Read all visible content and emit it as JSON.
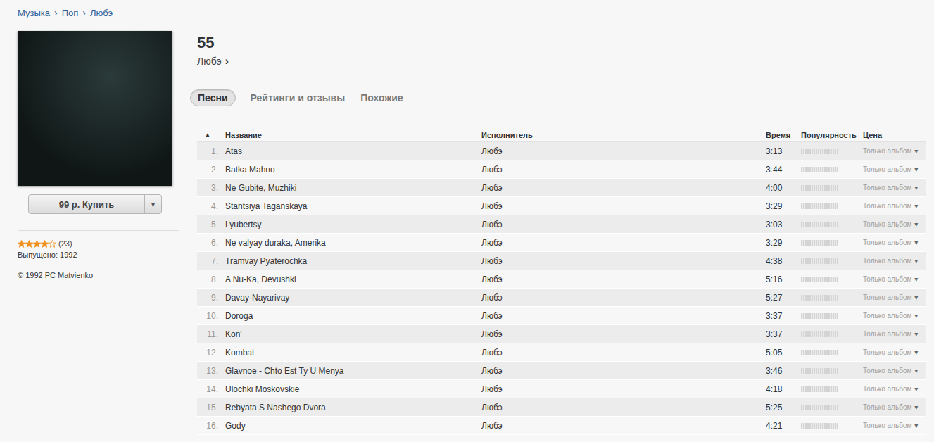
{
  "breadcrumb": {
    "items": [
      "Музыка",
      "Поп",
      "Любэ"
    ],
    "separator": "›"
  },
  "album": {
    "title": "55",
    "artist": "Любэ",
    "artist_arrow": "›",
    "buy_button": "99 р. Купить",
    "buy_menu": "▾",
    "rating": {
      "stars": 4,
      "count": "(23)"
    },
    "released": "Выпущено: 1992",
    "copyright": "© 1992 PC Matvienko"
  },
  "tabs": [
    {
      "label": "Песни",
      "selected": true
    },
    {
      "label": "Рейтинги и отзывы",
      "selected": false
    },
    {
      "label": "Похожие",
      "selected": false
    }
  ],
  "table": {
    "columns": [
      "▲",
      "Название",
      "Исполнитель",
      "Время",
      "Популярность",
      "Цена"
    ],
    "rows": [
      {
        "number": "1.",
        "title": "Atas",
        "artist": "Любэ",
        "time": "3:13",
        "level": 0,
        "price": "Только альбом",
        "menu": "▾"
      },
      {
        "number": "2.",
        "title": "Batka Mahno",
        "artist": "Любэ",
        "time": "3:44",
        "level": 0,
        "price": "Только альбом",
        "menu": "▾"
      },
      {
        "number": "3.",
        "title": "Ne Gubite, Muzhiki",
        "artist": "Любэ",
        "time": "4:00",
        "level": 0,
        "price": "Только альбом",
        "menu": "▾"
      },
      {
        "number": "4.",
        "title": "Stantsiya Taganskaya",
        "artist": "Любэ",
        "time": "3:29",
        "level": 0,
        "price": "Только альбом",
        "menu": "▾"
      },
      {
        "number": "5.",
        "title": "Lyubertsy",
        "artist": "Любэ",
        "time": "3:03",
        "level": 0,
        "price": "Только альбом",
        "menu": "▾"
      },
      {
        "number": "6.",
        "title": "Ne valyay duraka, Amerika",
        "artist": "Любэ",
        "time": "3:29",
        "level": 0,
        "price": "Только альбом",
        "menu": "▾"
      },
      {
        "number": "7.",
        "title": "Tramvay Pyaterochka",
        "artist": "Любэ",
        "time": "4:38",
        "level": 0,
        "price": "Только альбом",
        "menu": "▾"
      },
      {
        "number": "8.",
        "title": "A Nu-Ka, Devushki",
        "artist": "Любэ",
        "time": "5:16",
        "level": 0,
        "price": "Только альбом",
        "menu": "▾"
      },
      {
        "number": "9.",
        "title": "Davay-Nayarivay",
        "artist": "Любэ",
        "time": "5:27",
        "level": 0,
        "price": "Только альбом",
        "menu": "▾"
      },
      {
        "number": "10.",
        "title": "Doroga",
        "artist": "Любэ",
        "time": "3:37",
        "level": 0,
        "price": "Только альбом",
        "menu": "▾"
      },
      {
        "number": "11.",
        "title": "Kon'",
        "artist": "Любэ",
        "time": "3:37",
        "level": 0,
        "price": "Только альбом",
        "menu": "▾"
      },
      {
        "number": "12.",
        "title": "Kombat",
        "artist": "Любэ",
        "time": "5:05",
        "level": 0,
        "price": "Только альбом",
        "menu": "▾"
      },
      {
        "number": "13.",
        "title": "Glavnoe - Chto Est Ty U Menya",
        "artist": "Любэ",
        "time": "3:46",
        "level": 0,
        "price": "Только альбом",
        "menu": "▾"
      },
      {
        "number": "14.",
        "title": "Ulochki Moskovskie",
        "artist": "Любэ",
        "time": "4:18",
        "level": 0,
        "price": "Только альбом",
        "menu": "▾"
      },
      {
        "number": "15.",
        "title": "Rebyata S Nashego Dvora",
        "artist": "Любэ",
        "time": "5:25",
        "level": 0,
        "price": "Только альбом",
        "menu": "▾"
      },
      {
        "number": "16.",
        "title": "Gody",
        "artist": "Любэ",
        "time": "4:21",
        "level": 0,
        "price": "Только альбом",
        "menu": "▾"
      }
    ]
  }
}
